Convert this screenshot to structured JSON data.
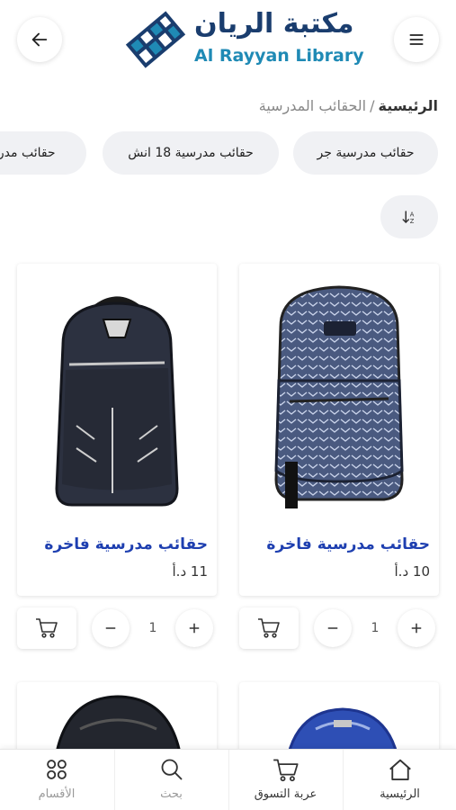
{
  "header": {
    "logo_text_ar": "مكتبة الريان",
    "logo_text_en": "Al Rayyan Library",
    "back_icon": "arrow-left-icon",
    "menu_icon": "hamburger-menu-icon"
  },
  "breadcrumb": {
    "home": "الرئيسية",
    "separator": "/",
    "current": "الحقائب المدرسية"
  },
  "chips": [
    {
      "label": "حقائب مدرسية جر"
    },
    {
      "label": "حقائب مدرسية 18 انش"
    },
    {
      "label": "حقائب مدرسية"
    }
  ],
  "sort": {
    "icon": "sort-icon"
  },
  "products": [
    {
      "title": "حقائب مدرسية فاخرة",
      "price": "10 د.أ",
      "quantity": "1"
    },
    {
      "title": "حقائب مدرسية فاخرة",
      "price": "11 د.أ",
      "quantity": "1"
    }
  ],
  "bottom_nav": [
    {
      "label": "الرئيسية",
      "icon": "home-icon"
    },
    {
      "label": "عربة التسوق",
      "icon": "cart-icon"
    },
    {
      "label": "بحث",
      "icon": "search-icon"
    },
    {
      "label": "الأقسام",
      "icon": "categories-icon"
    }
  ],
  "colors": {
    "brand_dark": "#1a3d6e",
    "brand_light": "#1f8ab5",
    "product_title": "#1e3fb0",
    "chip_bg": "#f0f1f4"
  }
}
